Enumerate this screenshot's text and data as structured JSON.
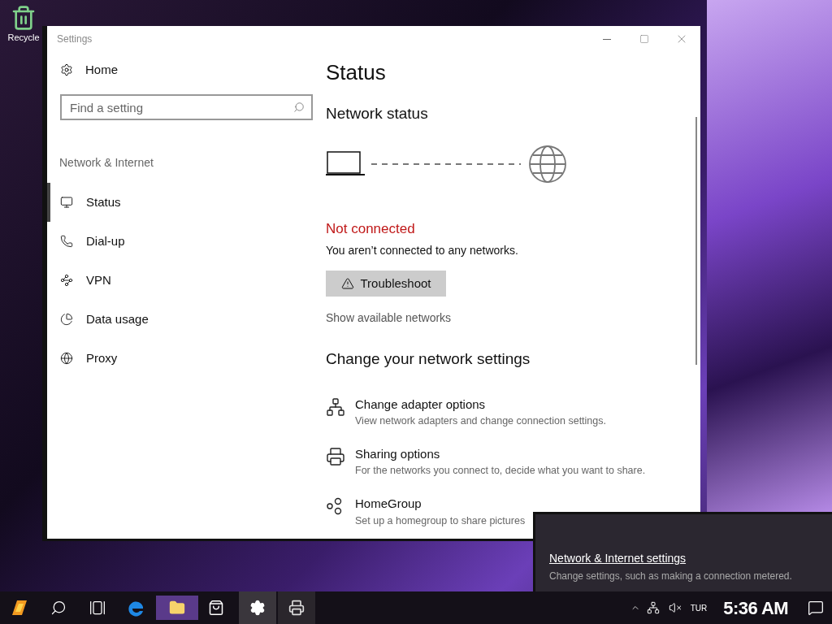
{
  "desktop": {
    "icons": [
      {
        "label": "Recycle"
      }
    ]
  },
  "window": {
    "title": "Settings"
  },
  "sidebar": {
    "home": "Home",
    "search": {
      "placeholder": "Find a setting"
    },
    "section": "Network & Internet",
    "items": [
      {
        "kind": "status",
        "label": "Status",
        "selected": true
      },
      {
        "kind": "dialup",
        "label": "Dial-up",
        "selected": false
      },
      {
        "kind": "vpn",
        "label": "VPN",
        "selected": false
      },
      {
        "kind": "data",
        "label": "Data usage",
        "selected": false
      },
      {
        "kind": "proxy",
        "label": "Proxy",
        "selected": false
      }
    ]
  },
  "main": {
    "title": "Status",
    "network_status": {
      "heading": "Network status",
      "state": "Not connected",
      "message": "You aren’t connected to any networks.",
      "troubleshoot": "Troubleshoot",
      "link": "Show available networks"
    },
    "change": {
      "heading": "Change your network settings",
      "items": [
        {
          "kind": "adapter",
          "title": "Change adapter options",
          "description": "View network adapters and change connection settings."
        },
        {
          "kind": "sharing",
          "title": "Sharing options",
          "description": "For the networks you connect to, decide what you want to share."
        },
        {
          "kind": "homegroup",
          "title": "HomeGroup",
          "description": "Set up a homegroup to share pictures"
        }
      ]
    }
  },
  "flyout": {
    "link": "Network & Internet settings",
    "description": "Change settings, such as making a connection metered."
  },
  "taskbar": {
    "language": "TUR",
    "clock": "5:36 AM"
  }
}
